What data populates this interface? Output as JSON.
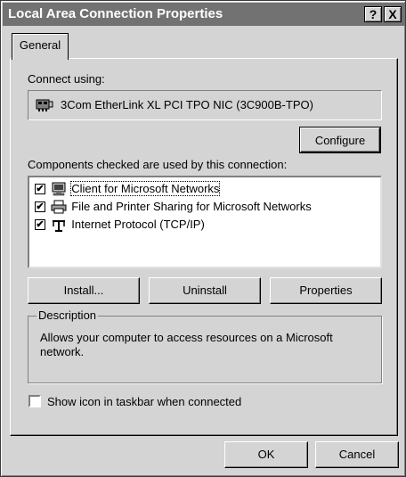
{
  "window": {
    "title": "Local Area Connection Properties",
    "help_btn": "?",
    "close_btn": "X"
  },
  "tabs": [
    {
      "label": "General"
    }
  ],
  "connect": {
    "label": "Connect using:",
    "adapter": "3Com EtherLink XL PCI TPO NIC (3C900B-TPO)",
    "configure": "Configure"
  },
  "components": {
    "label": "Components checked are used by this connection:",
    "items": [
      {
        "label": "Client for Microsoft Networks",
        "checked": true,
        "icon": "network-client-icon"
      },
      {
        "label": "File and Printer Sharing for Microsoft Networks",
        "checked": true,
        "icon": "printer-sharing-icon"
      },
      {
        "label": "Internet Protocol (TCP/IP)",
        "checked": true,
        "icon": "protocol-icon"
      }
    ],
    "check_mark": "✔"
  },
  "buttons": {
    "install": "Install...",
    "uninstall": "Uninstall",
    "properties": "Properties"
  },
  "description": {
    "legend": "Description",
    "text_line1": "Allows your computer to access resources on a Microsoft",
    "text_line2": "network."
  },
  "taskbar": {
    "label": "Show icon in taskbar when connected",
    "checked": false
  },
  "footer": {
    "ok": "OK",
    "cancel": "Cancel"
  }
}
